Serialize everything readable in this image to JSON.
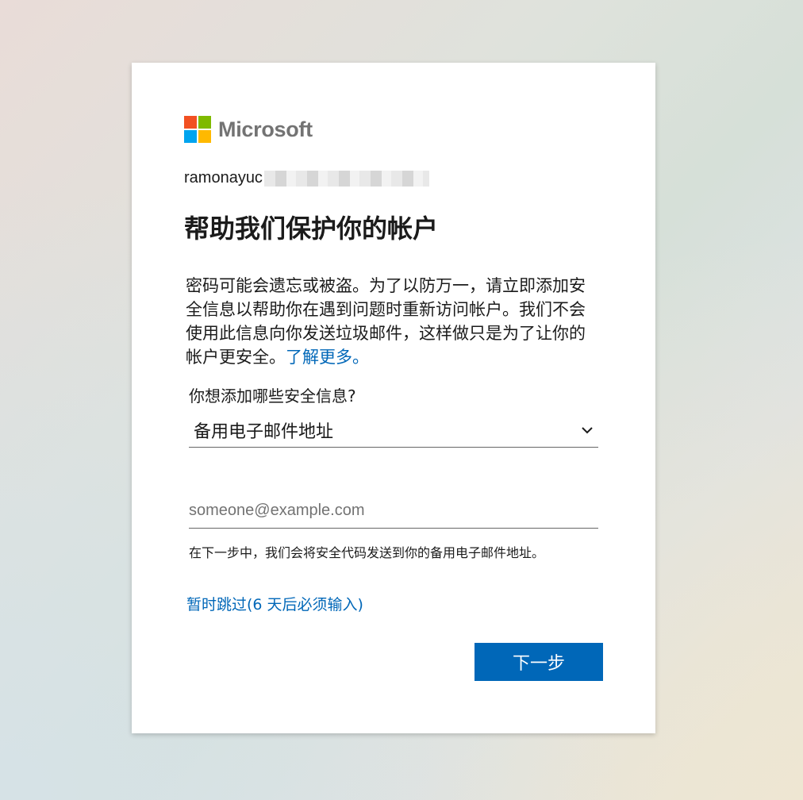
{
  "brand": {
    "name": "Microsoft",
    "icon": "microsoft-logo-icon",
    "colors": {
      "red": "#f25022",
      "green": "#7fba00",
      "blue": "#00a4ef",
      "yellow": "#ffb900"
    }
  },
  "identity": {
    "username_visible": "ramonayuc"
  },
  "page": {
    "title": "帮助我们保护你的帐户",
    "description": "密码可能会遗忘或被盗。为了以防万一，请立即添加安全信息以帮助你在遇到问题时重新访问帐户。我们不会使用此信息向你发送垃圾邮件，这样做只是为了让你的帐户更安全。",
    "learn_more_link": "了解更多。"
  },
  "form": {
    "question": "你想添加哪些安全信息?",
    "security_type": {
      "selected": "备用电子邮件地址",
      "icon": "chevron-down-icon"
    },
    "email": {
      "placeholder": "someone@example.com",
      "value": ""
    },
    "hint": "在下一步中，我们会将安全代码发送到你的备用电子邮件地址。"
  },
  "actions": {
    "skip_label": "暂时跳过(6 天后必须输入)",
    "next_label": "下一步"
  },
  "theme": {
    "accent": "#0067b8",
    "text": "#1b1b1b"
  }
}
